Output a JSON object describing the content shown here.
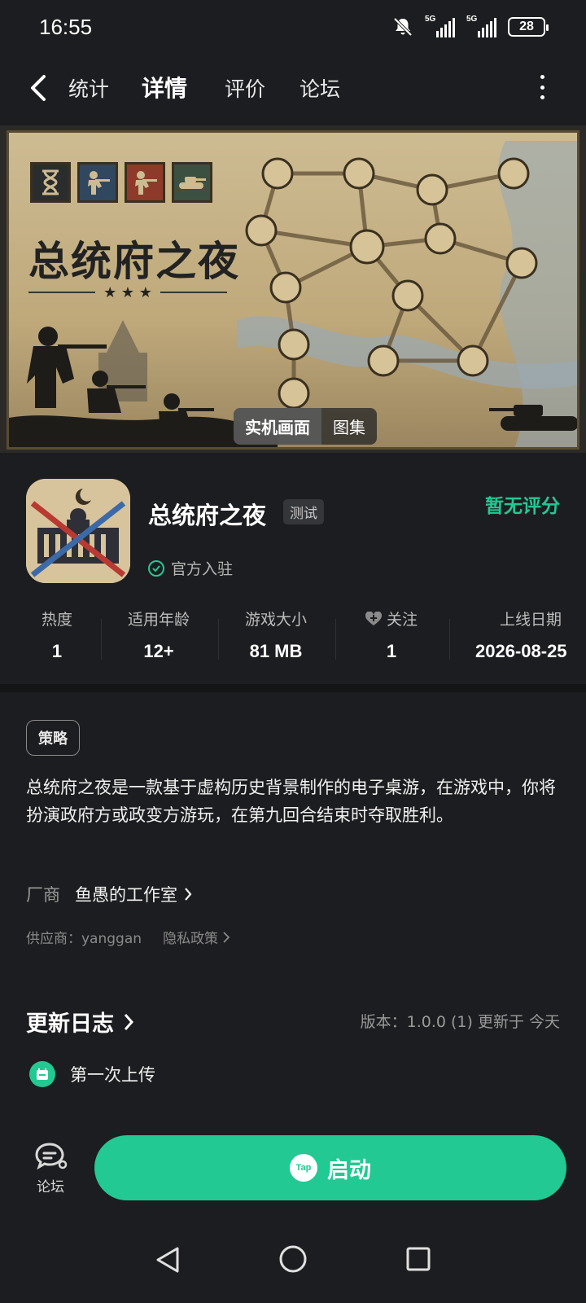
{
  "status_bar": {
    "time": "16:55",
    "signal1_label": "5G",
    "signal2_label": "5G",
    "battery": "28"
  },
  "nav": {
    "tabs": [
      {
        "label": "统计",
        "active": false
      },
      {
        "label": "详情",
        "active": true
      },
      {
        "label": "评价",
        "active": false
      },
      {
        "label": "论坛",
        "active": false
      }
    ]
  },
  "banner": {
    "title": "总统府之夜",
    "gallery_tabs": [
      "实机画面",
      "图集"
    ]
  },
  "app": {
    "name": "总统府之夜",
    "badge": "测试",
    "rating": "暂无评分",
    "official": "官方入驻"
  },
  "stats": [
    {
      "label": "热度",
      "value": "1"
    },
    {
      "label": "适用年龄",
      "value": "12+"
    },
    {
      "label": "游戏大小",
      "value": "81 MB"
    },
    {
      "label": "关注",
      "value": "1"
    },
    {
      "label": "上线日期",
      "value": "2026-08-25"
    }
  ],
  "details": {
    "tag": "策略",
    "description": "总统府之夜是一款基于虚构历史背景制作的电子桌游，在游戏中，你将扮演政府方或政变方游玩，在第九回合结束时夺取胜利。",
    "vendor_label": "厂商",
    "vendor_name": "鱼愚的工作室",
    "supplier": "供应商：yanggan",
    "privacy": "隐私政策"
  },
  "changelog": {
    "title": "更新日志",
    "version": "版本：1.0.0 (1)  更新于 今天",
    "items": [
      "第一次上传"
    ]
  },
  "bottom": {
    "forum_label": "论坛",
    "launch_label": "启动",
    "tap_logo": "Tap"
  },
  "colors": {
    "accent": "#22c993",
    "background": "#1c1d20"
  }
}
